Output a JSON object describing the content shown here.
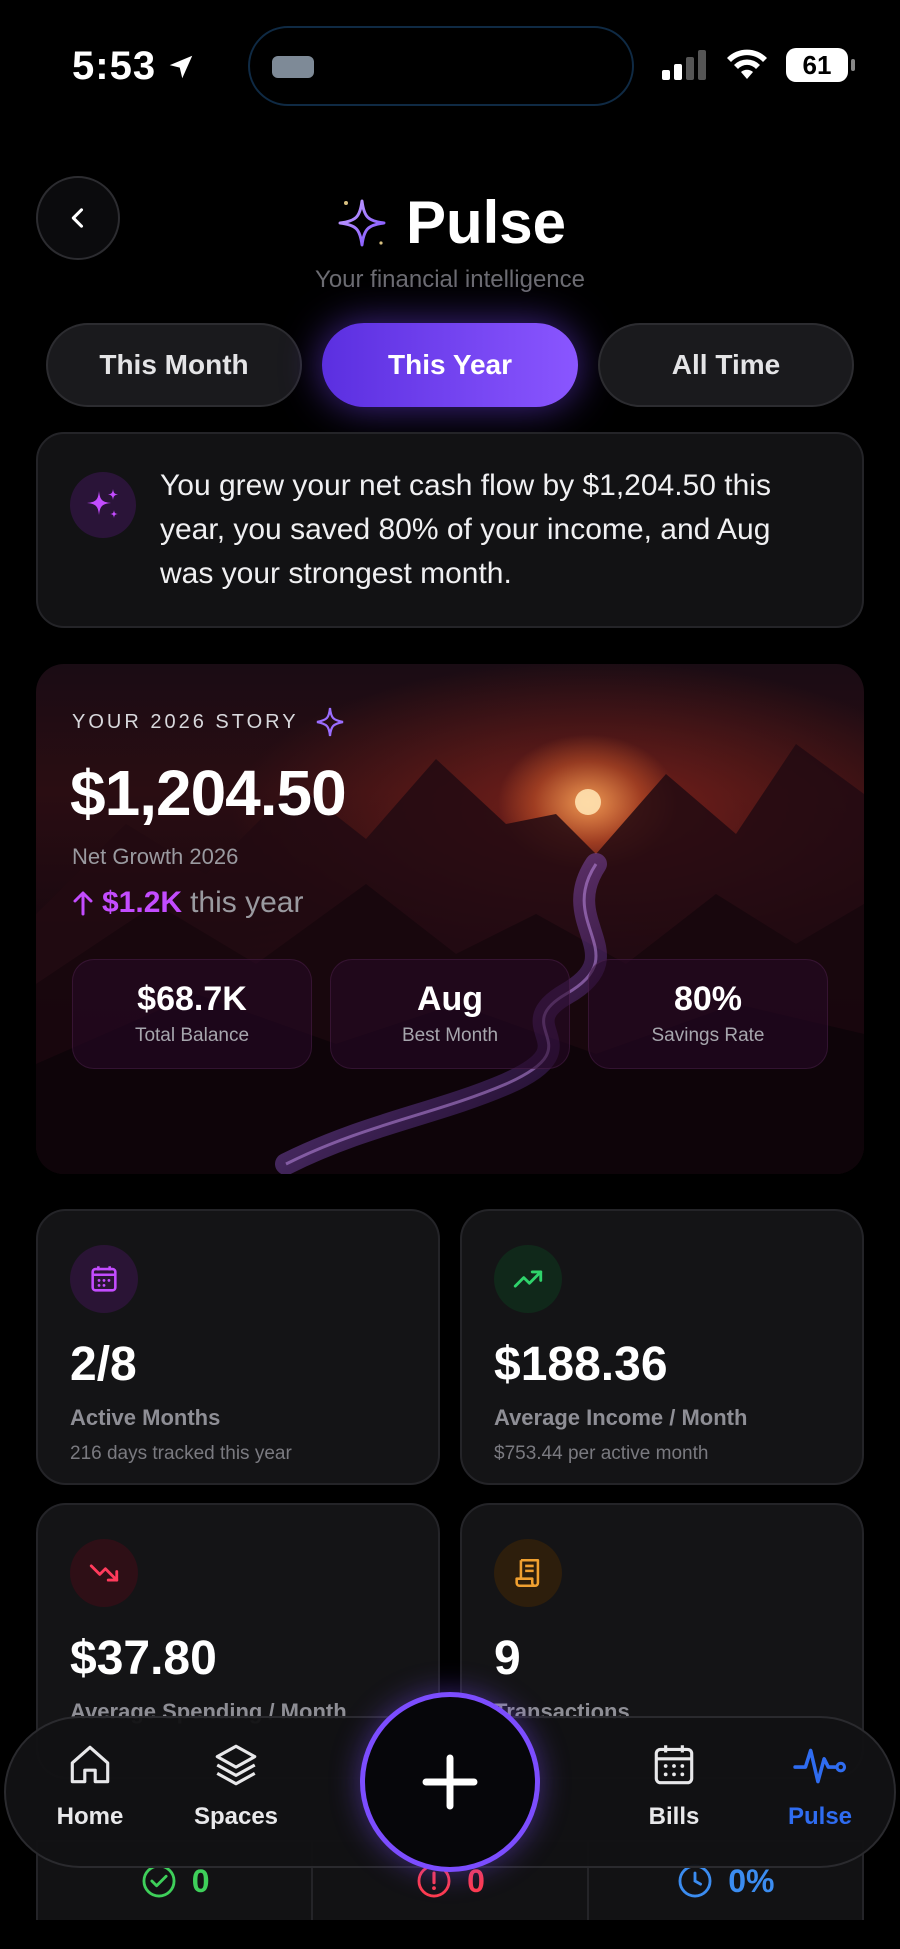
{
  "status_bar": {
    "time": "5:53",
    "battery": "61"
  },
  "header": {
    "title": "Pulse",
    "subtitle": "Your financial intelligence"
  },
  "periods": [
    {
      "label": "This Month",
      "selected": false
    },
    {
      "label": "This Year",
      "selected": true
    },
    {
      "label": "All Time",
      "selected": false
    }
  ],
  "insight": {
    "text": "You grew your net cash flow by $1,204.50 this year, you saved 80% of your income, and Aug was your strongest month."
  },
  "story": {
    "label": "YOUR 2026 STORY",
    "amount": "$1,204.50",
    "subtitle": "Net Growth 2026",
    "trend_value": "$1.2K",
    "trend_tail": "this year",
    "stats": [
      {
        "value": "$68.7K",
        "label": "Total Balance"
      },
      {
        "value": "Aug",
        "label": "Best Month"
      },
      {
        "value": "80%",
        "label": "Savings Rate"
      }
    ]
  },
  "metrics": [
    {
      "value": "2/8",
      "label": "Active Months",
      "sub": "216 days tracked this year",
      "icon": "calendar-icon"
    },
    {
      "value": "$188.36",
      "label": "Average Income / Month",
      "sub": "$753.44 per active month",
      "icon": "trending-up-icon"
    },
    {
      "value": "$37.80",
      "label": "Average Spending / Month",
      "sub": "",
      "icon": "trending-down-icon"
    },
    {
      "value": "9",
      "label": "Transactions",
      "sub": "",
      "icon": "receipt-icon"
    }
  ],
  "bottom_strip": [
    {
      "value": "0",
      "color": "#3ecf5a",
      "icon": "check-circle-icon"
    },
    {
      "value": "0",
      "color": "#ff3b4e",
      "icon": "alert-circle-icon"
    },
    {
      "value": "0%",
      "color": "#3b8cf0",
      "icon": "clock-icon"
    }
  ],
  "nav": {
    "items": [
      {
        "label": "Home",
        "icon": "home-icon"
      },
      {
        "label": "Spaces",
        "icon": "layers-icon"
      },
      {
        "label": "Bills",
        "icon": "calendar-icon"
      },
      {
        "label": "Pulse",
        "icon": "pulse-icon",
        "active": true
      }
    ]
  },
  "colors": {
    "accent": "#7c4dff",
    "active_nav": "#2f6cf0",
    "trend": "#c34cff"
  }
}
